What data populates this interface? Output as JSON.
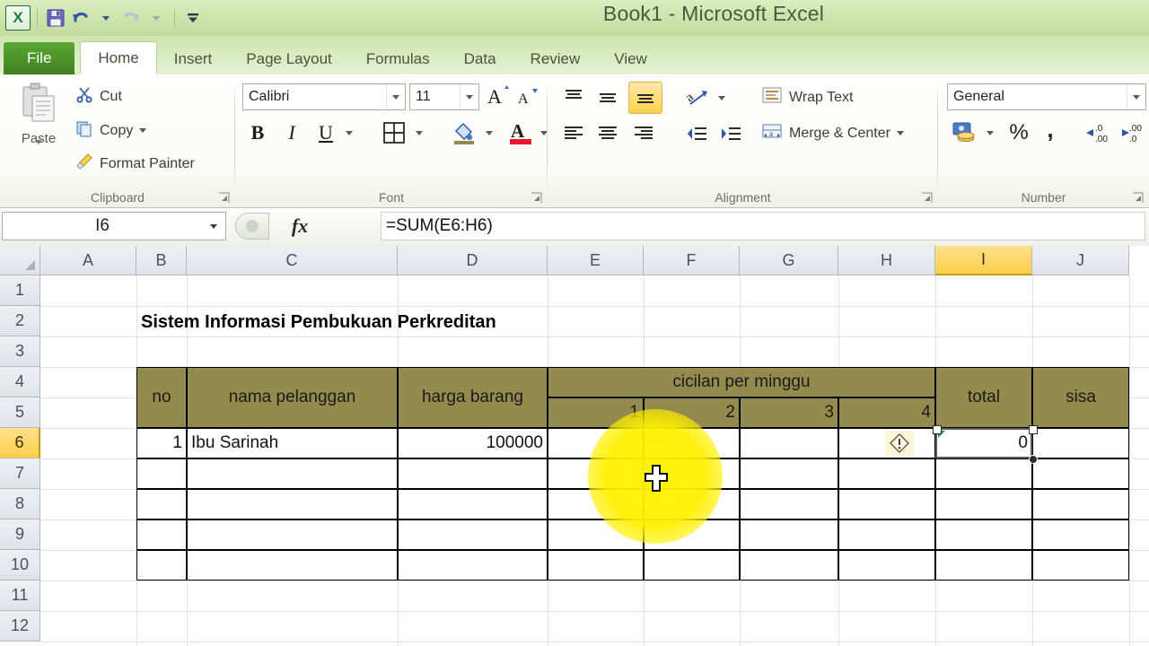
{
  "window": {
    "title": "Book1  -  Microsoft Excel",
    "quick_access": [
      {
        "name": "excel-logo",
        "label": "X"
      },
      {
        "name": "save-button",
        "label": "Save"
      },
      {
        "name": "undo-button",
        "label": "Undo"
      },
      {
        "name": "redo-button",
        "label": "Redo"
      },
      {
        "name": "customize-quick-access-toolbar-button",
        "label": "Customize Quick Access Toolbar"
      }
    ]
  },
  "ribbon": {
    "tabs": [
      {
        "label": "File",
        "active": false
      },
      {
        "label": "Home",
        "active": true
      },
      {
        "label": "Insert",
        "active": false
      },
      {
        "label": "Page Layout",
        "active": false
      },
      {
        "label": "Formulas",
        "active": false
      },
      {
        "label": "Data",
        "active": false
      },
      {
        "label": "Review",
        "active": false
      },
      {
        "label": "View",
        "active": false
      }
    ],
    "groups": {
      "clipboard": {
        "label": "Clipboard",
        "paste": "Paste",
        "cut": "Cut",
        "copy": "Copy",
        "format_painter": "Format Painter"
      },
      "font": {
        "label": "Font",
        "font_name": "Calibri",
        "font_size": "11",
        "bold": "B",
        "italic": "I",
        "underline": "U"
      },
      "alignment": {
        "label": "Alignment",
        "wrap_text": "Wrap Text",
        "merge_center": "Merge & Center"
      },
      "number": {
        "label": "Number",
        "format": "General",
        "percent": "%",
        "comma": ","
      }
    }
  },
  "formula_bar": {
    "name_box": "I6",
    "fx": "fx",
    "formula": "=SUM(E6:H6)"
  },
  "grid": {
    "columns": [
      "A",
      "B",
      "C",
      "D",
      "E",
      "F",
      "G",
      "H",
      "I",
      "J"
    ],
    "selected_column": "I",
    "rows": [
      "1",
      "2",
      "3",
      "4",
      "5",
      "6",
      "7",
      "8",
      "9",
      "10",
      "11",
      "12"
    ],
    "selected_row": "6",
    "selected_cell": "I6",
    "selected_cell_value": "0",
    "error_indicator_cell": "H6",
    "error_indicator_name": "formula-error-warning-icon"
  },
  "sheet": {
    "title": "Sistem Informasi Pembukuan Perkreditan",
    "table": {
      "headers": {
        "no": "no",
        "nama_pelanggan": "nama pelanggan",
        "harga_barang": "harga barang",
        "cicilan_group": "cicilan per minggu",
        "weeks": [
          "1",
          "2",
          "3",
          "4"
        ],
        "total": "total",
        "sisa": "sisa"
      },
      "rows": [
        {
          "no": "1",
          "nama_pelanggan": "Ibu Sarinah",
          "harga_barang": "100000",
          "weeks": [
            "",
            "",
            "",
            ""
          ],
          "total": "0",
          "sisa": ""
        },
        {
          "no": "",
          "nama_pelanggan": "",
          "harga_barang": "",
          "weeks": [
            "",
            "",
            "",
            ""
          ],
          "total": "",
          "sisa": ""
        },
        {
          "no": "",
          "nama_pelanggan": "",
          "harga_barang": "",
          "weeks": [
            "",
            "",
            "",
            ""
          ],
          "total": "",
          "sisa": ""
        },
        {
          "no": "",
          "nama_pelanggan": "",
          "harga_barang": "",
          "weeks": [
            "",
            "",
            "",
            ""
          ],
          "total": "",
          "sisa": ""
        },
        {
          "no": "",
          "nama_pelanggan": "",
          "harga_barang": "",
          "weeks": [
            "",
            "",
            "",
            ""
          ],
          "total": "",
          "sisa": ""
        }
      ]
    }
  },
  "colors": {
    "table_header_bg": "#938b4e",
    "selection_highlight": "#ffcf4d",
    "cursor_glow": "#fff200",
    "ribbon_accent": "#5aa832"
  }
}
